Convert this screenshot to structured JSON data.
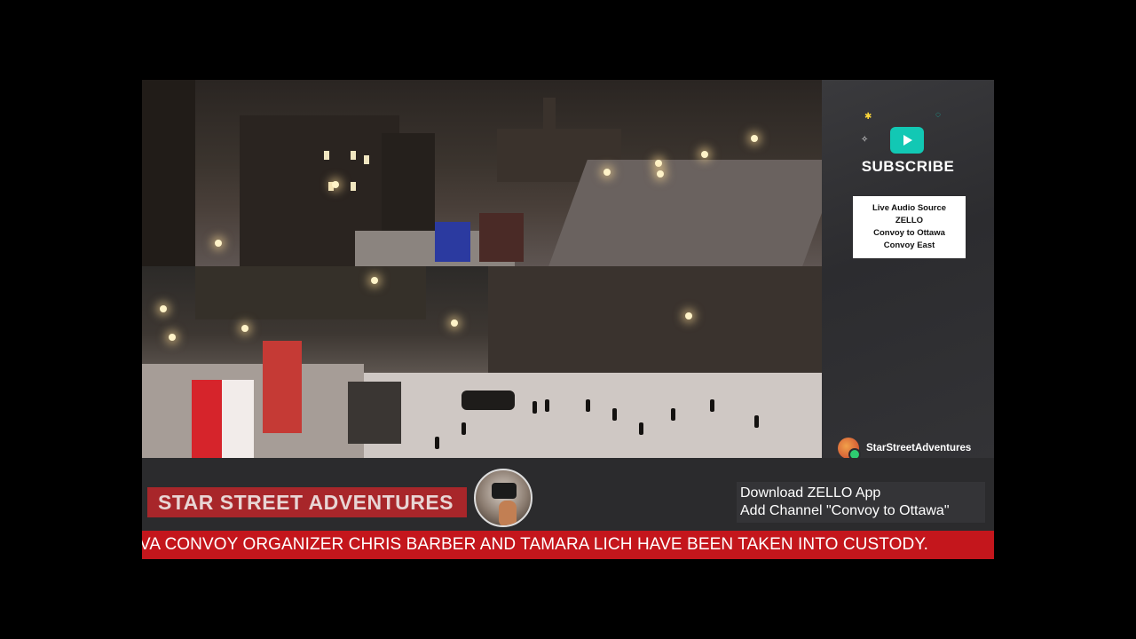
{
  "side_panel": {
    "subscribe_label": "SUBSCRIBE",
    "subscribe_icon": "play-button-icon",
    "audio_source_lines": [
      "Live Audio Source",
      "ZELLO",
      "Convoy to Ottawa",
      "Convoy East"
    ],
    "channel_name": "StarStreetAdventures"
  },
  "lower_bar": {
    "brand_title": "STAR STREET ADVENTURES",
    "zello_line1": "Download ZELLO App",
    "zello_line2": "Add Channel \"Convoy to Ottawa\""
  },
  "ticker": {
    "text": "VA CONVOY ORGANIZER CHRIS BARBER AND TAMARA LICH HAVE BEEN TAKEN INTO CUSTODY."
  },
  "colors": {
    "ticker_red": "#c4161c",
    "brand_red": "#a8262a",
    "subscribe_teal": "#12c8b4",
    "panel_grey": "#2c2c2f"
  }
}
